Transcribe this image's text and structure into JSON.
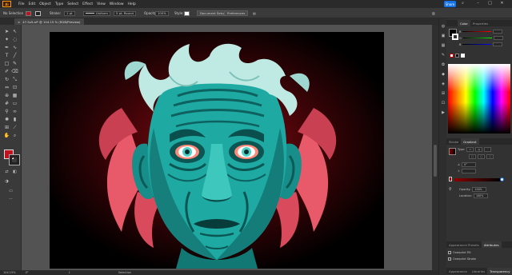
{
  "menubar": {
    "app_logo": "Ai",
    "items": [
      "File",
      "Edit",
      "Object",
      "Type",
      "Select",
      "Effect",
      "View",
      "Window",
      "Help"
    ],
    "share_label": "Share"
  },
  "controlbar": {
    "selection_label": "No Selection",
    "stroke_label": "Stroke:",
    "stroke_value": "1 pt",
    "uniform_label": "Uniform",
    "brush_label": "5 pt. Round",
    "opacity_label": "Opacity:",
    "opacity_value": "100%",
    "style_label": "Style:",
    "document_setup": "Document Setup",
    "preferences": "Preferences"
  },
  "document": {
    "tab_title": "47.5x5.ai* @ 104.15 % (RGB/Preview)"
  },
  "statusbar": {
    "zoom": "104.15%",
    "angle": "0°",
    "artboard": "1",
    "mode": "Selection"
  },
  "panels": {
    "color_tabs": [
      "Color",
      "Properties"
    ],
    "stroke_tabs": [
      "Stroke",
      "Gradient"
    ],
    "gradient": {
      "type_label": "Type:",
      "angle_value": "0°",
      "opacity_label": "Opacity:",
      "opacity_value": "100%",
      "location_label": "Location:",
      "location_value": "100%"
    },
    "bottom_tabs_1": [
      "Appearance Presets",
      "Attributes"
    ],
    "checkboxes": [
      "Overprint Fill",
      "Overprint Stroke"
    ],
    "bottom_tabs_2": [
      "Appearance",
      "Libraries",
      "Transparency"
    ]
  },
  "colors": {
    "accent": "#1473e6",
    "fill_red": "#c1121f",
    "teal_skin": "#1fa9a3",
    "hair": "#bfe9e3",
    "hair_red": "#e8596a"
  }
}
